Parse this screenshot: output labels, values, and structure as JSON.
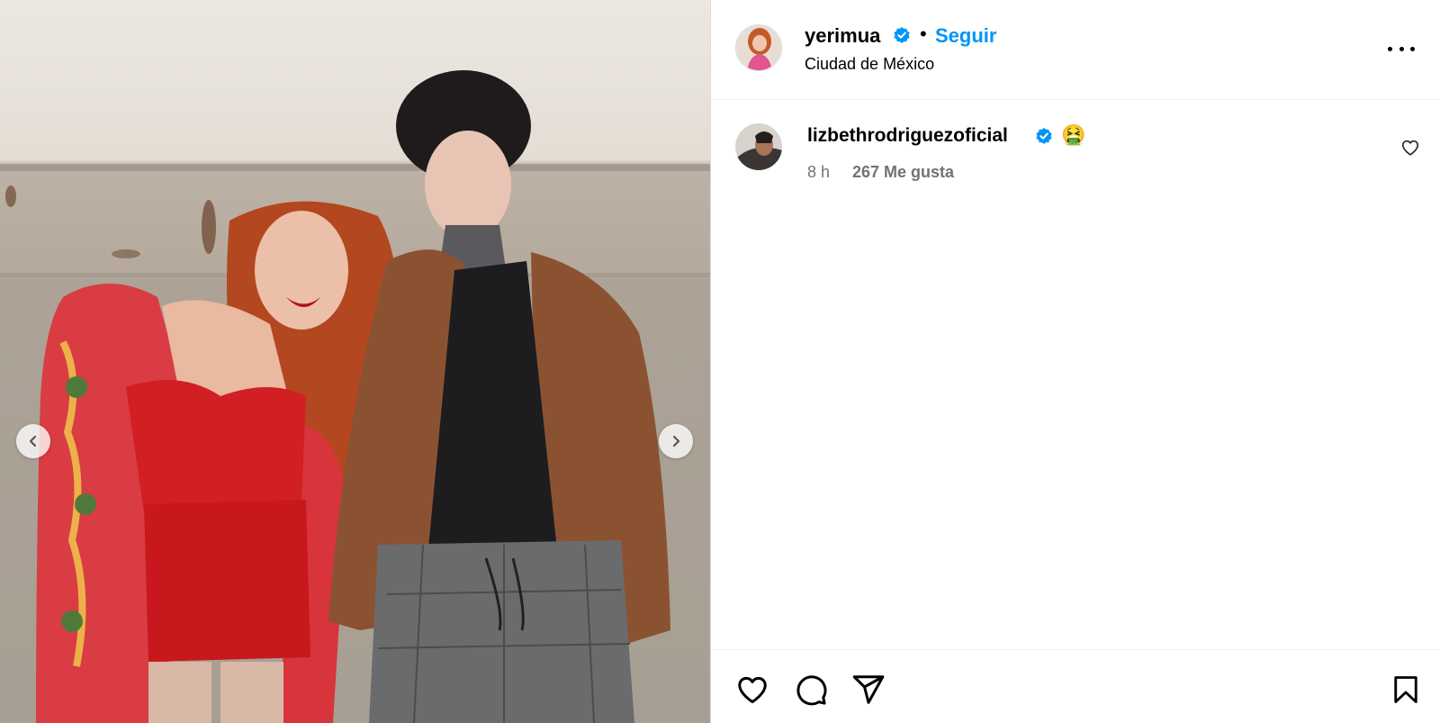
{
  "header": {
    "username": "yerimua",
    "separator": "•",
    "follow_label": "Seguir",
    "location": "Ciudad de México",
    "verified_icon": "verified-badge-icon",
    "more_icon": "more-options-icon"
  },
  "comment": {
    "username": "lizbethrodriguezoficial",
    "emoji": "🤮",
    "time": "8 h",
    "likes": "267 Me gusta",
    "like_icon": "heart-outline-icon"
  },
  "actions": {
    "like_icon": "heart-icon",
    "comment_icon": "comment-icon",
    "share_icon": "send-icon",
    "save_icon": "bookmark-icon"
  },
  "media": {
    "prev_icon": "chevron-left-icon",
    "next_icon": "chevron-right-icon"
  },
  "colors": {
    "accent": "#0095f6",
    "verified": "#0095f6",
    "muted_text": "#737373",
    "border": "#dbdbdb"
  }
}
